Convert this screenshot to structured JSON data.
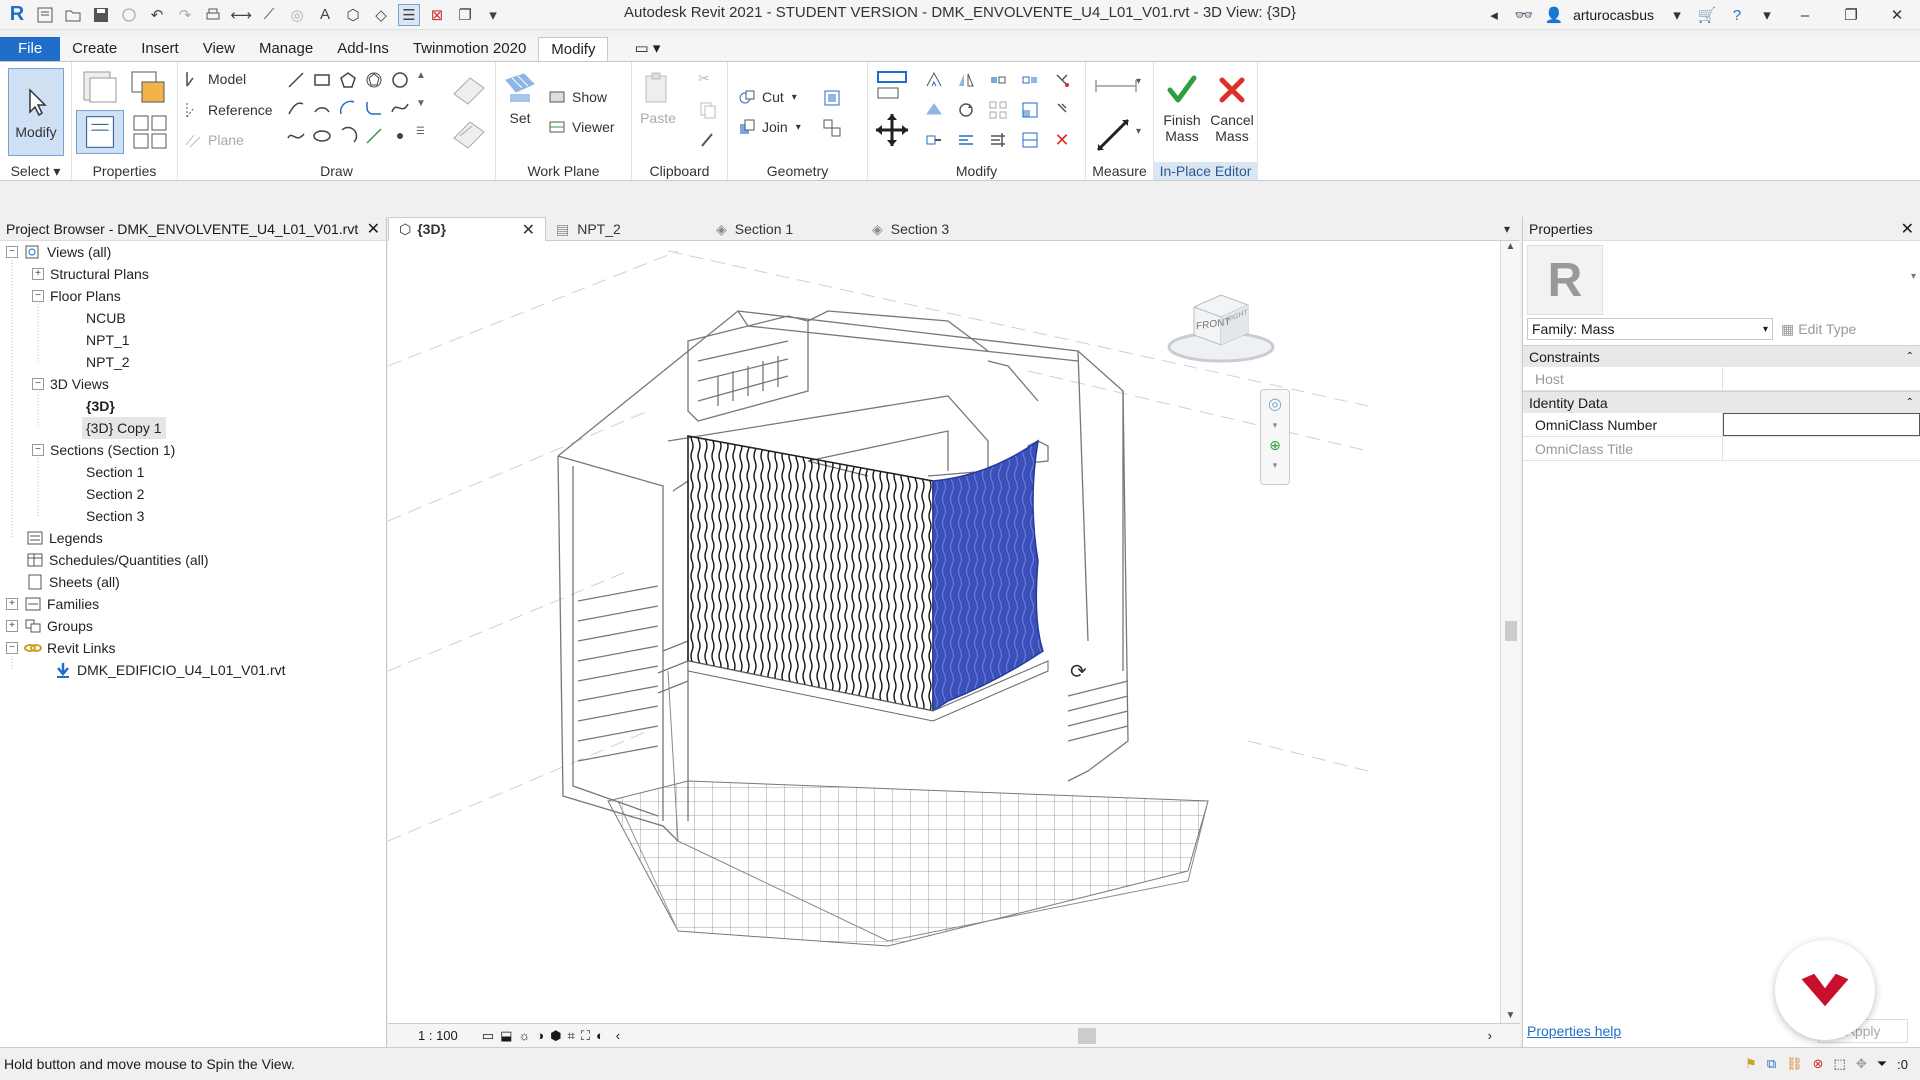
{
  "window": {
    "title": "Autodesk Revit 2021 - STUDENT VERSION - DMK_ENVOLVENTE_U4_L01_V01.rvt - 3D View: {3D}",
    "username": "arturocasbus"
  },
  "menu": {
    "tabs": [
      "File",
      "Create",
      "Insert",
      "View",
      "Manage",
      "Add-Ins",
      "Twinmotion 2020",
      "Modify"
    ],
    "active": "Modify"
  },
  "ribbon": {
    "select": {
      "modify_label": "Modify",
      "panel_label": "Select"
    },
    "properties": {
      "panel_label": "Properties"
    },
    "draw": {
      "model": "Model",
      "reference": "Reference",
      "plane": "Plane",
      "panel_label": "Draw"
    },
    "workplane": {
      "set": "Set",
      "show": "Show",
      "viewer": "Viewer",
      "panel_label": "Work Plane"
    },
    "clipboard": {
      "paste": "Paste",
      "panel_label": "Clipboard"
    },
    "geometry": {
      "cut": "Cut",
      "join": "Join",
      "panel_label": "Geometry"
    },
    "modify": {
      "panel_label": "Modify"
    },
    "measure": {
      "panel_label": "Measure"
    },
    "inplace": {
      "finish_line1": "Finish",
      "finish_line2": "Mass",
      "cancel_line1": "Cancel",
      "cancel_line2": "Mass",
      "panel_label": "In-Place Editor"
    }
  },
  "browser": {
    "title": "Project Browser - DMK_ENVOLVENTE_U4_L01_V01.rvt",
    "items": {
      "views_all": "Views (all)",
      "structural_plans": "Structural Plans",
      "floor_plans": "Floor Plans",
      "ncub": "NCUB",
      "npt1": "NPT_1",
      "npt2": "NPT_2",
      "views3d": "3D Views",
      "view3d": "{3D}",
      "view3d_copy": "{3D} Copy 1",
      "sections": "Sections (Section 1)",
      "section1": "Section 1",
      "section2": "Section 2",
      "section3": "Section 3",
      "legends": "Legends",
      "schedules": "Schedules/Quantities (all)",
      "sheets": "Sheets (all)",
      "families": "Families",
      "groups": "Groups",
      "revit_links": "Revit Links",
      "link_file": "DMK_EDIFICIO_U4_L01_V01.rvt"
    }
  },
  "viewtabs": [
    "{3D}",
    "NPT_2",
    "Section 1",
    "Section 3"
  ],
  "viewcube": {
    "front": "FRONT",
    "right": "RIGHT"
  },
  "view_controls": {
    "scale": "1 : 100"
  },
  "properties": {
    "title": "Properties",
    "family": "Family: Mass",
    "edit_type": "Edit Type",
    "constraints": "Constraints",
    "host": "Host",
    "identity": "Identity Data",
    "omniclass_number": "OmniClass Number",
    "omniclass_title": "OmniClass Title",
    "help": "Properties help",
    "apply": "Apply"
  },
  "status": {
    "message": "Hold button and move mouse to Spin the View.",
    "filter_count": ":0"
  },
  "colors": {
    "accent": "#1f6ec9",
    "mass_blue": "#3a4fb8",
    "finish_green": "#2e9e3e",
    "cancel_red": "#d9322b",
    "brand_red": "#c8102e"
  }
}
